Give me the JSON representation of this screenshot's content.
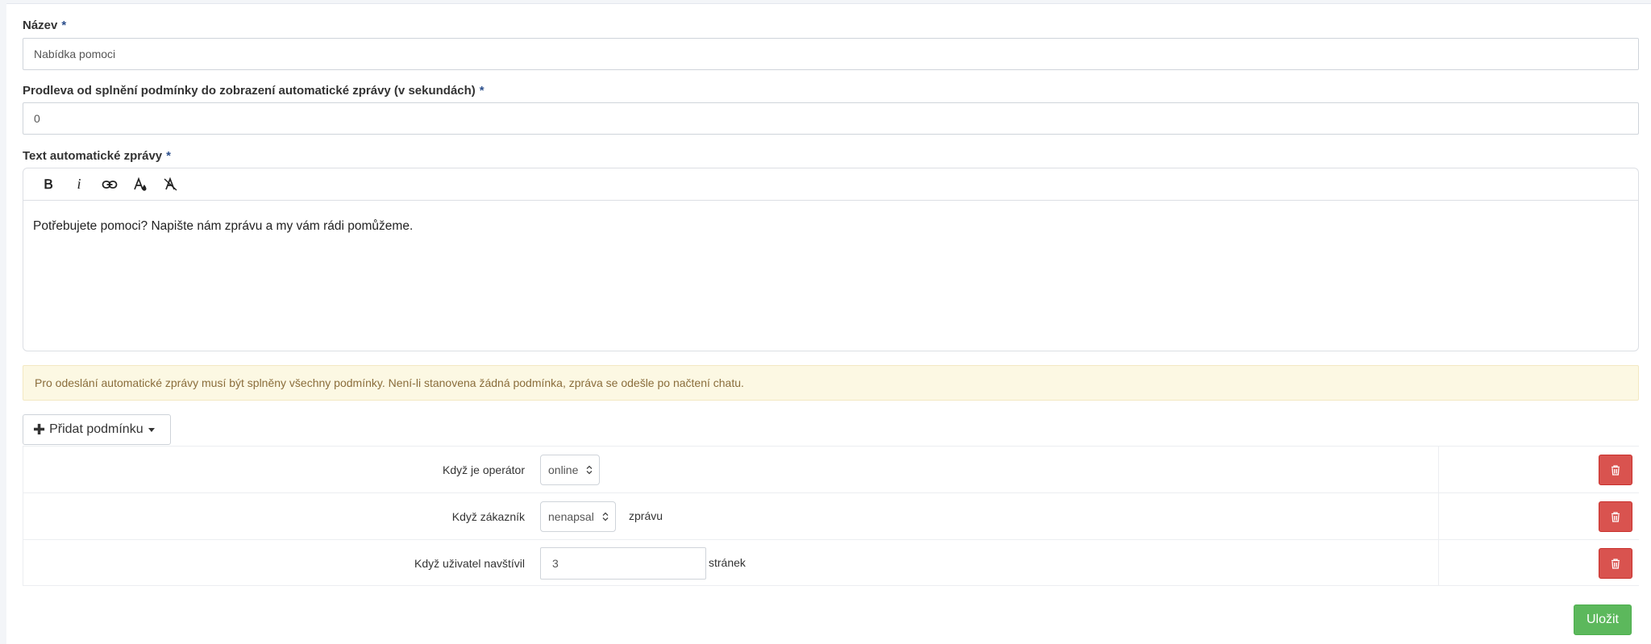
{
  "form": {
    "name_label": "Název",
    "name_value": "Nabídka pomoci",
    "delay_label": "Prodleva od splnění podmínky do zobrazení automatické zprávy (v sekundách)",
    "delay_value": "0",
    "message_label": "Text automatické zprávy",
    "required_mark": "*"
  },
  "editor": {
    "toolbar": [
      "bold-icon",
      "italic-icon",
      "link-icon",
      "text-color-icon",
      "clear-format-icon"
    ],
    "bold_glyph": "B",
    "italic_glyph": "i",
    "content": "Potřebujete pomoci? Napište nám zprávu a my vám rádi pomůžeme."
  },
  "alert": {
    "text": "Pro odeslání automatické zprávy musí být splněny všechny podmínky. Není-li stanovena žádná podmínka, zpráva se odešle po načtení chatu."
  },
  "conditions": {
    "add_label": "Přidat podmínku",
    "rows": [
      {
        "label": "Když je operátor",
        "control": "select",
        "value": "online",
        "suffix": ""
      },
      {
        "label": "Když zákazník",
        "control": "select",
        "value": "nenapsal",
        "suffix": "zprávu"
      },
      {
        "label": "Když uživatel navštívil",
        "control": "input",
        "value": "3",
        "suffix": "stránek"
      }
    ]
  },
  "actions": {
    "save_label": "Uložit"
  },
  "colors": {
    "danger": "#d9534f",
    "success": "#5cb85c",
    "warning_bg": "#fcf8e3",
    "warning_text": "#8a6d3b"
  }
}
